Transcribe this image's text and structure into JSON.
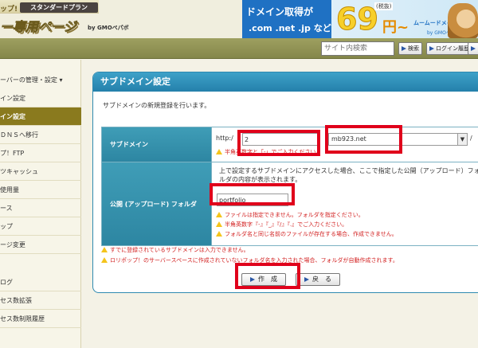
{
  "header": {
    "logo_fragment": "ップ!",
    "plan_label": "スタンダードプラン",
    "title": "ー専用ページ",
    "gmo": "by GMOペパボ"
  },
  "banner": {
    "headline": "ドメイン取得が",
    "tlds": ".com .net .jp など",
    "price": "69",
    "price_note": "(税抜)",
    "yen": "円~",
    "brand": "ムームードメイン",
    "brand_gmo": "by GMOペパボ"
  },
  "toolbar": {
    "search_placeholder": "サイト内検索",
    "search_button": "検索",
    "login_history_button": "ログイン履歴",
    "logout_button": "ログ"
  },
  "sidebar": {
    "items": [
      {
        "label": "ーバーの管理・設定 ▾",
        "active": false
      },
      {
        "label": "イン設定",
        "active": false
      },
      {
        "label": "イン設定",
        "active": true
      },
      {
        "label": "ＤＮＳへ移行",
        "active": false
      },
      {
        "label": "プ！FTP",
        "active": false
      },
      {
        "label": "ツキャッシュ",
        "active": false
      },
      {
        "label": "使用量",
        "active": false
      },
      {
        "label": "ース",
        "active": false
      },
      {
        "label": "ップ",
        "active": false
      },
      {
        "label": "ージ変更",
        "active": false
      },
      {
        "label": "ログ",
        "active": false
      },
      {
        "label": "セス数拡張",
        "active": false
      },
      {
        "label": "セス数制限履歴",
        "active": false
      }
    ]
  },
  "main": {
    "title": "サブドメイン設定",
    "description": "サブドメインの新規登録を行います。",
    "subdomain_label": "サブドメイン",
    "http_prefix": "http:/",
    "subdomain_value": "2",
    "domain_value": "mb923.net",
    "slash": "/",
    "subdomain_warning": "半角英数字と「-」でご入力ください。",
    "folder_label": "公開 (アップロード) フォルダ",
    "folder_description": "上で設定するサブドメインにアクセスした場合、ここで指定した公開（アップロード）フォルダの内容が表示されます。",
    "folder_value": "portfolio",
    "folder_warnings": [
      "ファイルは指定できません。フォルダを指定ください。",
      "半角英数字『-』『_』『/』『.』でご入力ください。",
      "フォルダ名と同じ名前のファイルが存在する場合、作成できません。"
    ],
    "notes": [
      "すでに登録されているサブドメインは入力できません。",
      "ロリポップ！のサーバースペースに作成されていないフォルダ名を入力された場合、フォルダが自動作成されます。"
    ],
    "create_button": "作　成",
    "back_button": "戻　る"
  },
  "colors": {
    "accent_blue": "#2f8ab0",
    "sidebar_active": "#8a7a1e",
    "highlight_red": "#e0001b",
    "warning_red": "#d21f1f"
  }
}
